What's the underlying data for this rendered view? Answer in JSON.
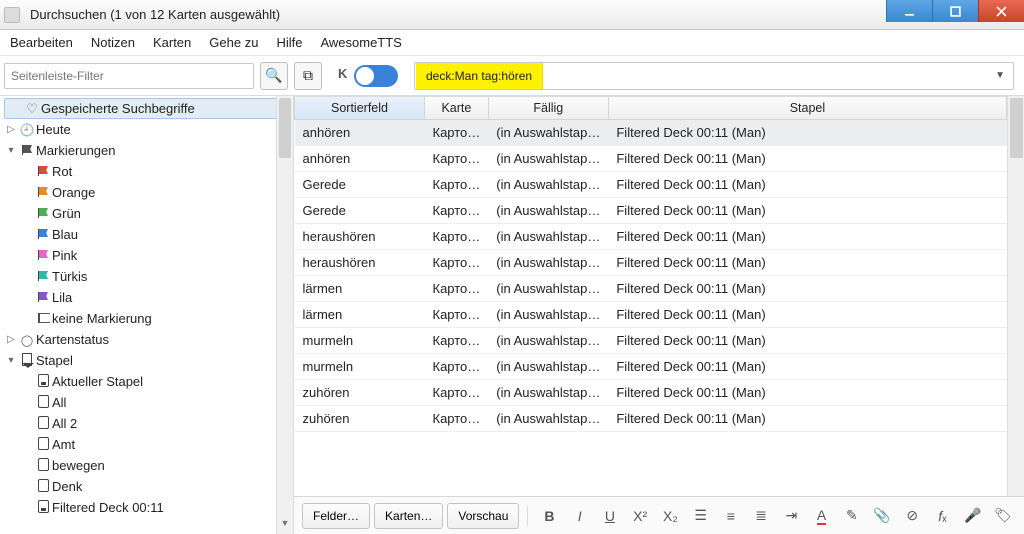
{
  "window": {
    "title": "Durchsuchen (1 von 12 Karten ausgewählt)"
  },
  "menu": {
    "items": [
      "Bearbeiten",
      "Notizen",
      "Karten",
      "Gehe zu",
      "Hilfe",
      "AwesomeTTS"
    ]
  },
  "toolbar": {
    "sidebar_filter_placeholder": "Seitenleiste-Filter",
    "toggle_letter": "K",
    "search_query": "deck:Man tag:hören"
  },
  "sidebar": {
    "saved": "Gespeicherte Suchbegriffe",
    "today": "Heute",
    "flags": {
      "label": "Markierungen",
      "items": [
        {
          "label": "Rot",
          "color": "#d94b3a"
        },
        {
          "label": "Orange",
          "color": "#e68b2e"
        },
        {
          "label": "Grün",
          "color": "#4caf50"
        },
        {
          "label": "Blau",
          "color": "#3a82d7"
        },
        {
          "label": "Pink",
          "color": "#e667c7"
        },
        {
          "label": "Türkis",
          "color": "#2bbab0"
        },
        {
          "label": "Lila",
          "color": "#8655c7"
        }
      ],
      "none": "keine Markierung"
    },
    "cardstate": "Kartenstatus",
    "decks": {
      "label": "Stapel",
      "items": [
        "Aktueller Stapel",
        "All",
        "All 2",
        "Amt",
        "bewegen",
        "Denk",
        "Filtered Deck 00:11"
      ]
    }
  },
  "table": {
    "headers": {
      "sort": "Sortierfeld",
      "card": "Karte",
      "due": "Fällig",
      "deck": "Stapel"
    },
    "rows": [
      {
        "sort": "anhören",
        "card": "Карто…",
        "due": "(in Auswahlstap…",
        "deck": "Filtered Deck 00:11 (Man)",
        "sel": true
      },
      {
        "sort": "anhören",
        "card": "Карто…",
        "due": "(in Auswahlstap…",
        "deck": "Filtered Deck 00:11 (Man)"
      },
      {
        "sort": "Gerede",
        "card": "Карто…",
        "due": "(in Auswahlstap…",
        "deck": "Filtered Deck 00:11 (Man)"
      },
      {
        "sort": "Gerede",
        "card": "Карто…",
        "due": "(in Auswahlstap…",
        "deck": "Filtered Deck 00:11 (Man)"
      },
      {
        "sort": "heraushören",
        "card": "Карто…",
        "due": "(in Auswahlstap…",
        "deck": "Filtered Deck 00:11 (Man)"
      },
      {
        "sort": "heraushören",
        "card": "Карто…",
        "due": "(in Auswahlstap…",
        "deck": "Filtered Deck 00:11 (Man)"
      },
      {
        "sort": "lärmen",
        "card": "Карто…",
        "due": "(in Auswahlstap…",
        "deck": "Filtered Deck 00:11 (Man)"
      },
      {
        "sort": "lärmen",
        "card": "Карто…",
        "due": "(in Auswahlstap…",
        "deck": "Filtered Deck 00:11 (Man)"
      },
      {
        "sort": "murmeln",
        "card": "Карто…",
        "due": "(in Auswahlstap…",
        "deck": "Filtered Deck 00:11 (Man)"
      },
      {
        "sort": "murmeln",
        "card": "Карто…",
        "due": "(in Auswahlstap…",
        "deck": "Filtered Deck 00:11 (Man)"
      },
      {
        "sort": "zuhören",
        "card": "Карто…",
        "due": "(in Auswahlstap…",
        "deck": "Filtered Deck 00:11 (Man)"
      },
      {
        "sort": "zuhören",
        "card": "Карто…",
        "due": "(in Auswahlstap…",
        "deck": "Filtered Deck 00:11 (Man)"
      }
    ]
  },
  "editor": {
    "fields": "Felder…",
    "cards": "Karten…",
    "preview": "Vorschau"
  }
}
